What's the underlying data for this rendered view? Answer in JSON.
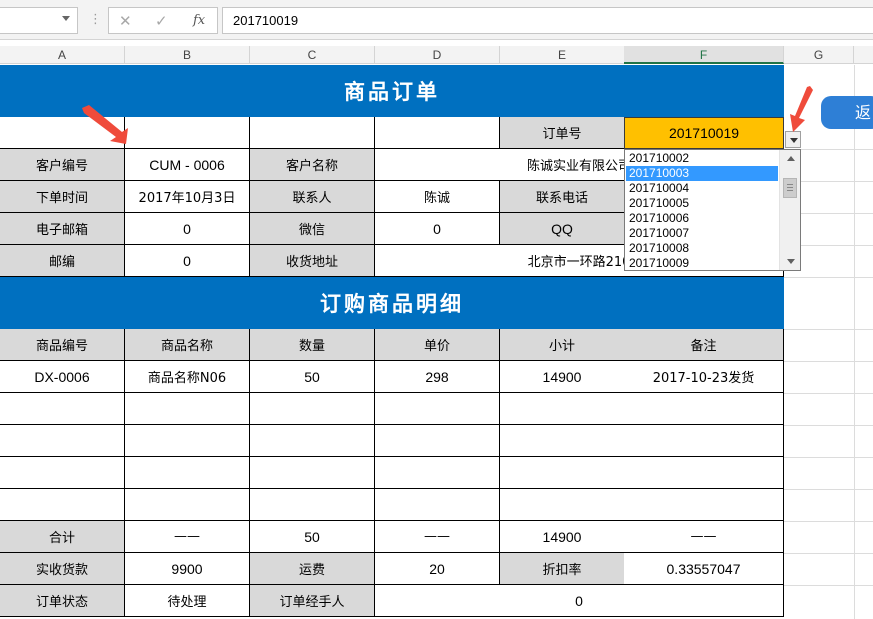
{
  "formula_bar": {
    "name_box": "",
    "separator": "⋮",
    "cancel_glyph": "✕",
    "enter_glyph": "✓",
    "fx_label": "fx",
    "value": "201710019"
  },
  "columns": [
    "A",
    "B",
    "C",
    "D",
    "E",
    "F",
    "G"
  ],
  "selected_column": "F",
  "header": {
    "title": "商品订单",
    "order_no_label": "订单号",
    "order_no_value": "201710019"
  },
  "customer": {
    "id_label": "客户编号",
    "id_value": "CUM - 0006",
    "name_label": "客户名称",
    "name_value": "陈诚实业有限公司",
    "time_label": "下单时间",
    "time_value": "2017年10月3日",
    "contact_label": "联系人",
    "contact_value": "陈诚",
    "phone_label": "联系电话",
    "email_label": "电子邮箱",
    "email_value": "0",
    "wechat_label": "微信",
    "wechat_value": "0",
    "qq_label": "QQ",
    "postcode_label": "邮编",
    "postcode_value": "0",
    "address_label": "收货地址",
    "address_value": "北京市一环路210"
  },
  "detail": {
    "title": "订购商品明细",
    "headers": [
      "商品编号",
      "商品名称",
      "数量",
      "单价",
      "小计",
      "备注"
    ],
    "rows": [
      [
        "DX-0006",
        "商品名称N06",
        "50",
        "298",
        "14900",
        "2017-10-23发货"
      ],
      [
        "",
        "",
        "",
        "",
        "",
        ""
      ],
      [
        "",
        "",
        "",
        "",
        "",
        ""
      ],
      [
        "",
        "",
        "",
        "",
        "",
        ""
      ],
      [
        "",
        "",
        "",
        "",
        "",
        ""
      ]
    ]
  },
  "summary": {
    "total_label": "合计",
    "total_b": "——",
    "total_qty": "50",
    "total_d": "——",
    "total_sub": "14900",
    "total_f": "——",
    "paid_label": "实收货款",
    "paid_value": "9900",
    "freight_label": "运费",
    "freight_value": "20",
    "discount_label": "折扣率",
    "discount_value": "0.33557047",
    "status_label": "订单状态",
    "status_value": "待处理",
    "handler_label": "订单经手人",
    "handler_value": "0"
  },
  "dropdown": {
    "items": [
      "201710002",
      "201710003",
      "201710004",
      "201710005",
      "201710006",
      "201710007",
      "201710008",
      "201710009"
    ],
    "highlighted_index": 1
  },
  "return_button": "返",
  "colors": {
    "band": "#0070c0",
    "label_fill": "#d9d9d9",
    "order_fill": "#ffc000",
    "highlight": "#3399ff",
    "arrow": "#ef4b3b",
    "button": "#2e7fd6"
  }
}
